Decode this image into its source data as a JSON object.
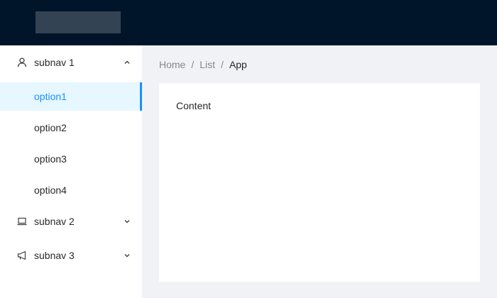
{
  "colors": {
    "header_bg": "#001529",
    "accent": "#1890ff",
    "selected_bg": "#e6f7ff",
    "page_bg": "#f0f2f5"
  },
  "sidebar": {
    "subnavs": [
      {
        "label": "subnav 1",
        "icon": "user-icon",
        "expanded": true,
        "items": [
          "option1",
          "option2",
          "option3",
          "option4"
        ],
        "selected_item": "option1"
      },
      {
        "label": "subnav 2",
        "icon": "laptop-icon",
        "expanded": false
      },
      {
        "label": "subnav 3",
        "icon": "notification-icon",
        "expanded": false
      }
    ]
  },
  "breadcrumb": {
    "items": [
      "Home",
      "List",
      "App"
    ],
    "separator": "/"
  },
  "content": {
    "text": "Content"
  }
}
